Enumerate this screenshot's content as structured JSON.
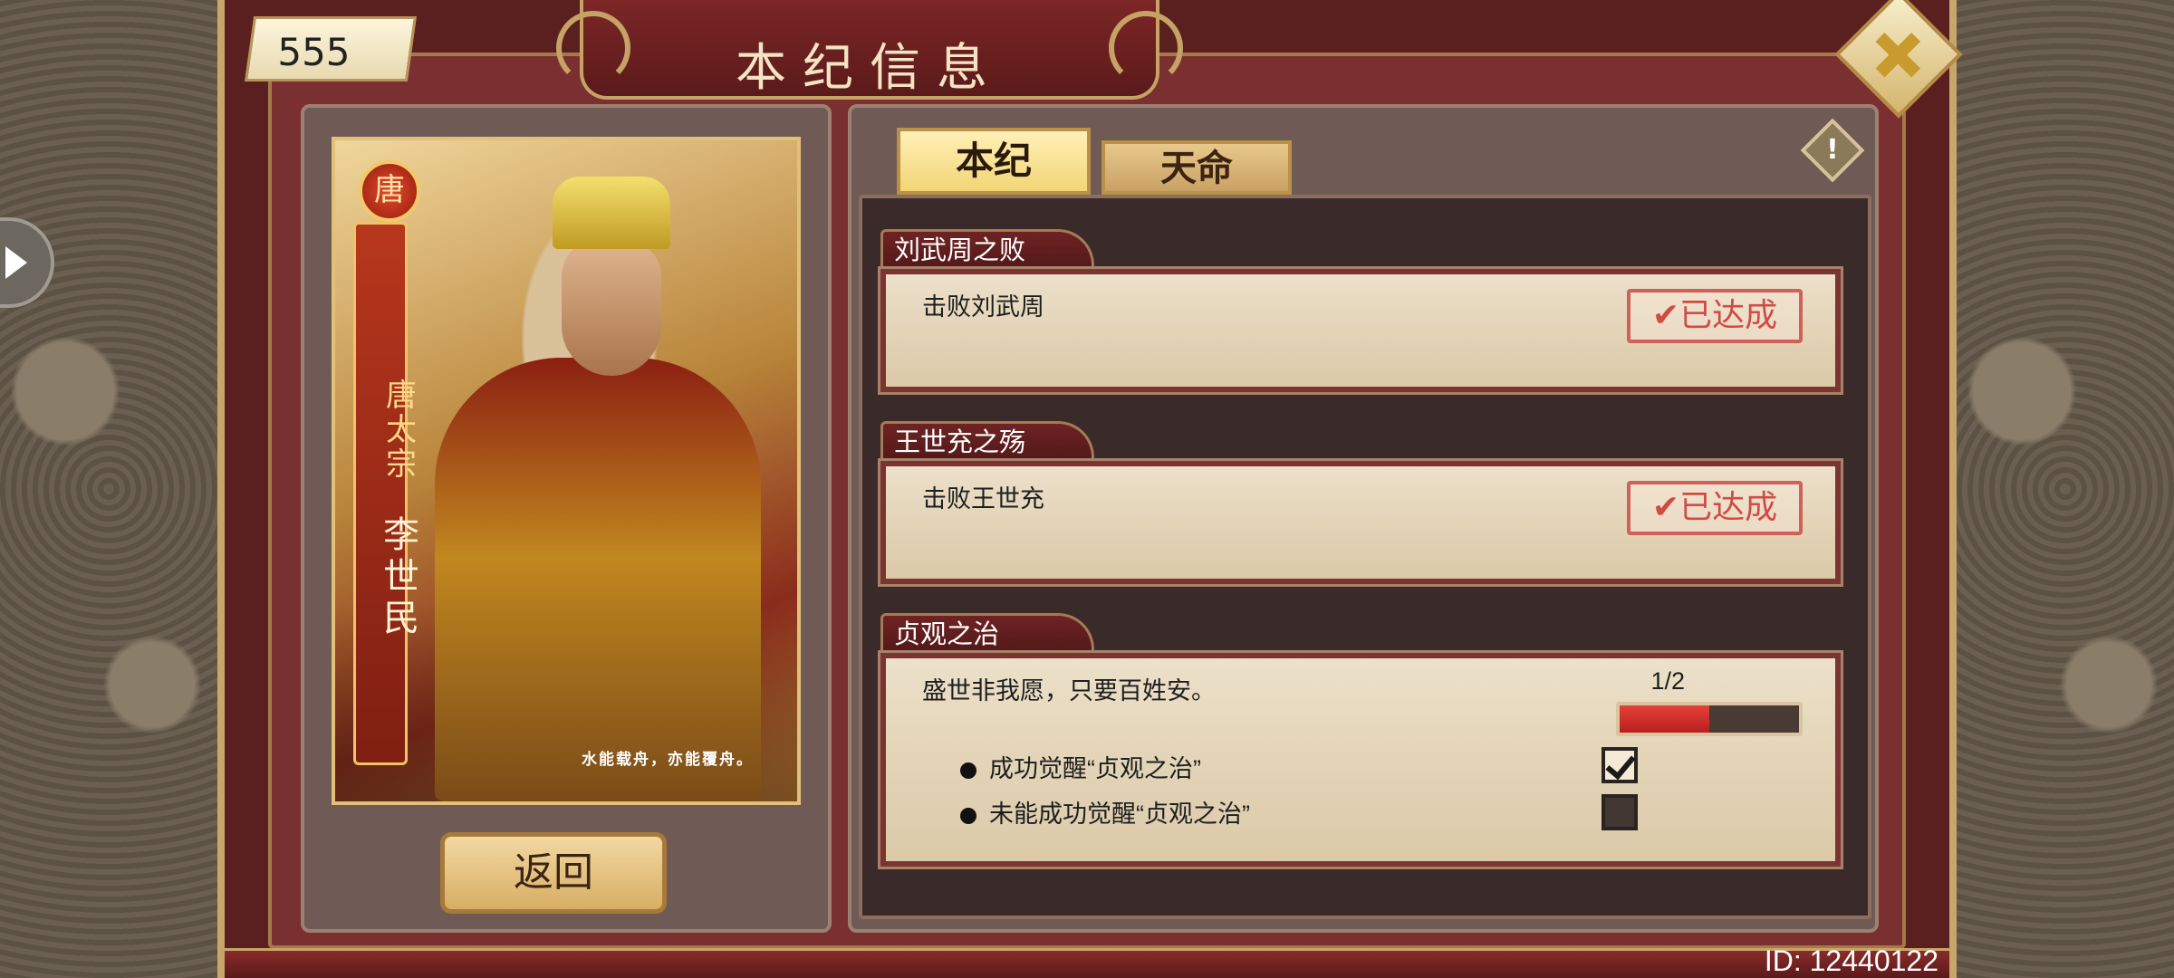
{
  "header": {
    "title": "本纪信息"
  },
  "currency": {
    "value": "555"
  },
  "card": {
    "emblem": "唐",
    "title": "唐太宗",
    "name": "李世民",
    "caption": "水能载舟，亦能覆舟。"
  },
  "buttons": {
    "back_label": "返回"
  },
  "tabs": [
    {
      "label": "本纪",
      "active": true
    },
    {
      "label": "天命",
      "active": false
    }
  ],
  "info_button": {
    "glyph": "!"
  },
  "sections": [
    {
      "title": "刘武周之败",
      "description": "击败刘武周",
      "stamp": "✔已达成"
    },
    {
      "title": "王世充之殇",
      "description": "击败王世充",
      "stamp": "✔已达成"
    },
    {
      "title": "贞观之治",
      "description": "盛世非我愿，只要百姓安。",
      "progress": {
        "label": "1/2",
        "fraction": 0.5
      },
      "conditions": [
        {
          "text": "成功觉醒“贞观之治”",
          "checked": true
        },
        {
          "text": "未能成功觉醒“贞观之治”",
          "checked": false
        }
      ]
    }
  ],
  "footer": {
    "id_text": "ID: 12440122"
  },
  "colors": {
    "accent_gold": "#c7a265",
    "frame_red": "#5a1f1f",
    "stamp_red": "#cf4c45"
  }
}
